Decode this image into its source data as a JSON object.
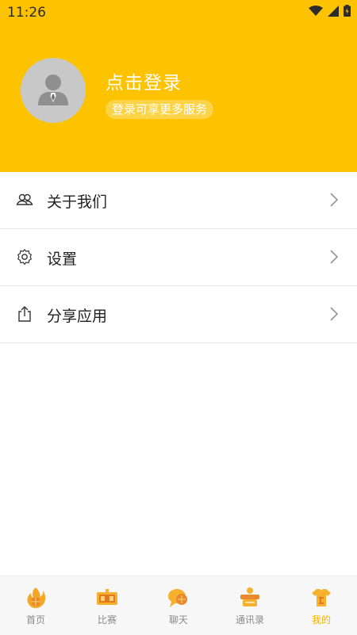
{
  "status_bar": {
    "time": "11:26"
  },
  "profile": {
    "login_title": "点击登录",
    "login_subtitle": "登录可享更多服务"
  },
  "menu": [
    {
      "label": "关于我们",
      "icon": "people-icon"
    },
    {
      "label": "设置",
      "icon": "gear-icon"
    },
    {
      "label": "分享应用",
      "icon": "share-icon"
    }
  ],
  "tabs": [
    {
      "label": "首页",
      "icon": "home-basketball-icon",
      "active": false
    },
    {
      "label": "比赛",
      "icon": "scoreboard-icon",
      "active": false
    },
    {
      "label": "聊天",
      "icon": "chat-bubble-icon",
      "active": false
    },
    {
      "label": "通讯录",
      "icon": "contacts-icon",
      "active": false
    },
    {
      "label": "我的",
      "icon": "profile-shirt-icon",
      "active": true
    }
  ],
  "colors": {
    "accent": "#fdc300",
    "active_tab": "#f3b300",
    "inactive_tab": "#8a8a8a"
  }
}
